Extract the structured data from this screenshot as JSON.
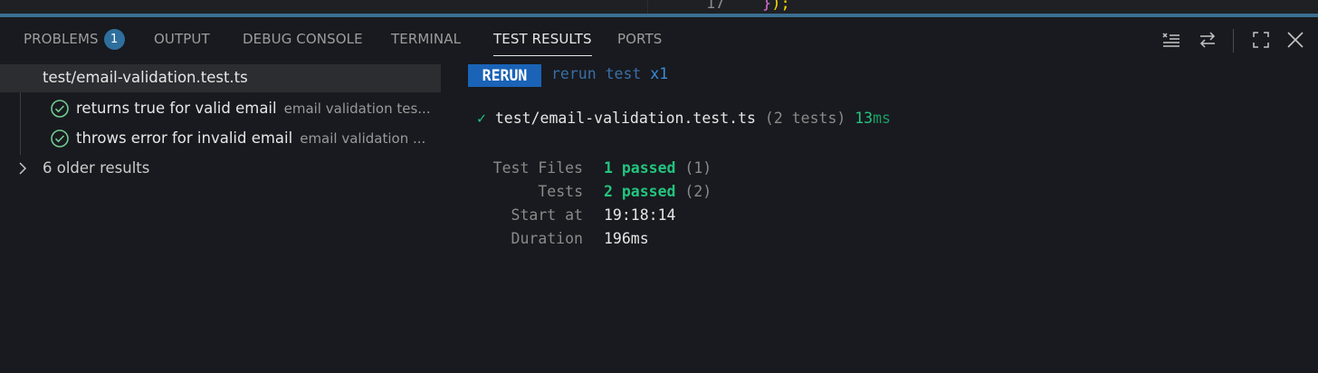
{
  "editor": {
    "line_number": "17",
    "code_open": "}",
    "code_close": ");"
  },
  "panel_tabs": {
    "problems": "PROBLEMS",
    "problems_count": "1",
    "output": "OUTPUT",
    "debug_console": "DEBUG CONSOLE",
    "terminal": "TERMINAL",
    "test_results": "TEST RESULTS",
    "ports": "PORTS",
    "active": "TEST RESULTS"
  },
  "panel_actions": {
    "icons": [
      "clear-results-icon",
      "toggle-layout-icon",
      "maximize-panel-icon",
      "close-panel-icon"
    ]
  },
  "results_tree": {
    "file": "test/email-validation.test.ts",
    "tests": [
      {
        "name": "returns true for valid email",
        "description": "email validation tes...",
        "status": "passed"
      },
      {
        "name": "throws error for invalid email",
        "description": "email validation ...",
        "status": "passed"
      }
    ],
    "older_results": "6 older results"
  },
  "output": {
    "rerun_label": "RERUN",
    "rerun_text": "rerun test",
    "rerun_count": "x1",
    "check": "✓",
    "file": "test/email-validation.test.ts",
    "test_count": "(2 tests)",
    "duration_value": "13",
    "duration_unit": "ms",
    "summary": {
      "test_files_label": "Test Files",
      "test_files_passed": "1 passed",
      "test_files_total": "(1)",
      "tests_label": "Tests",
      "tests_passed": "2 passed",
      "tests_total": "(2)",
      "start_label": "Start at",
      "start_value": "19:18:14",
      "duration_label": "Duration",
      "duration_value": "196ms"
    }
  },
  "colors": {
    "accent": "#3b6f91",
    "pass_green": "#23c47e",
    "rerun_blue": "#1a63b7"
  }
}
